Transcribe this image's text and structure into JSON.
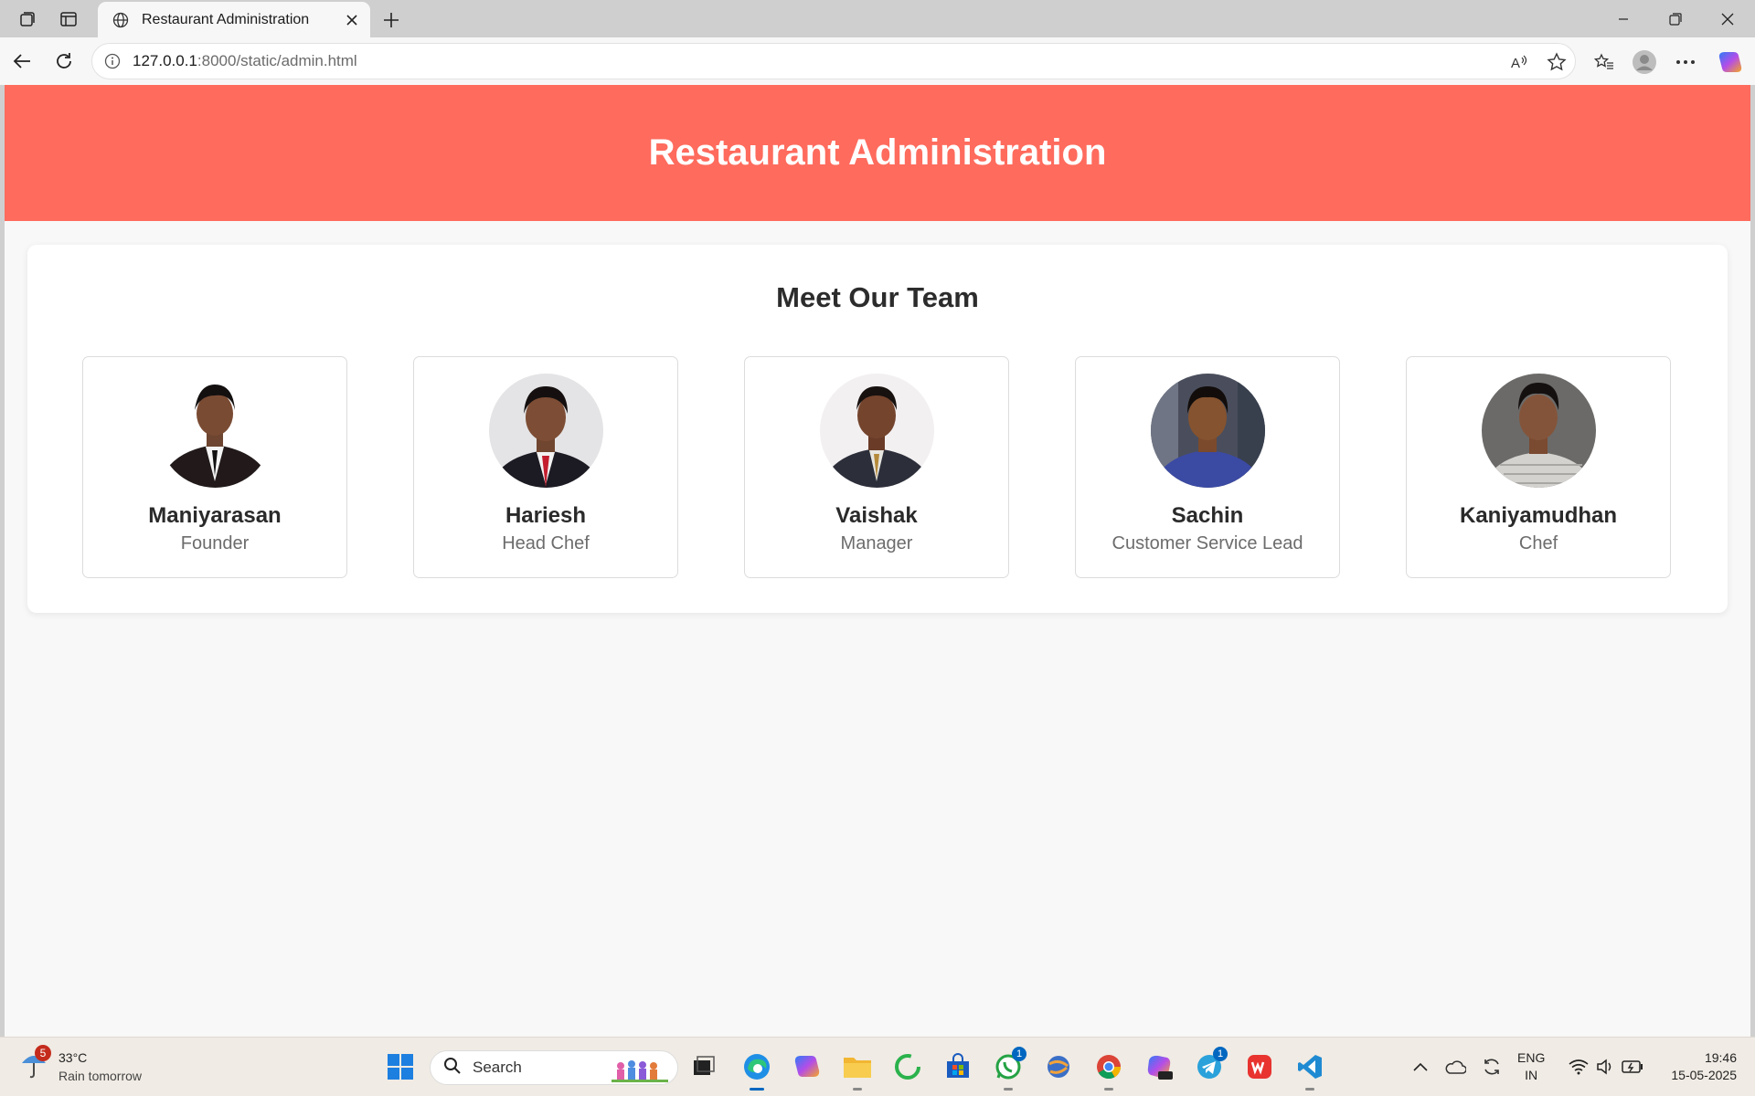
{
  "browser": {
    "tab_title": "Restaurant Administration",
    "url_host": "127.0.0.1",
    "url_path": ":8000/static/admin.html"
  },
  "page": {
    "header_title": "Restaurant Administration",
    "section_title": "Meet Our Team",
    "team": [
      {
        "name": "Maniyarasan",
        "role": "Founder"
      },
      {
        "name": "Hariesh",
        "role": "Head Chef"
      },
      {
        "name": "Vaishak",
        "role": "Manager"
      },
      {
        "name": "Sachin",
        "role": "Customer Service Lead"
      },
      {
        "name": "Kaniyamudhan",
        "role": "Chef"
      }
    ],
    "colors": {
      "header": "#ff6b5d",
      "background": "#f8f8f8"
    }
  },
  "taskbar": {
    "weather_badge": "5",
    "temperature": "33°C",
    "condition": "Rain tomorrow",
    "search_label": "Search",
    "whatsapp_badge": "1",
    "telegram_badge": "1",
    "lang_top": "ENG",
    "lang_bottom": "IN",
    "time": "19:46",
    "date": "15-05-2025"
  }
}
